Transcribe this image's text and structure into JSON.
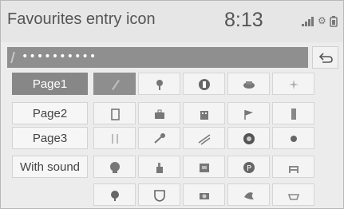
{
  "header": {
    "title": "Favourites entry icon",
    "clock": "8:13",
    "status_icons": [
      "signal-bars-icon",
      "settings-gear-icon",
      "battery-icon"
    ]
  },
  "input": {
    "value": "••••••••••"
  },
  "back_button": {
    "icon": "return-arrow-icon"
  },
  "pages": [
    {
      "label": "Page1",
      "active": true
    },
    {
      "label": "Page2",
      "active": false
    },
    {
      "label": "Page3",
      "active": false
    },
    {
      "label": "With sound",
      "active": false
    }
  ],
  "icon_grid": [
    [
      "pencil-icon",
      "pin-icon",
      "home-icon",
      "car-icon",
      "sparkle-icon"
    ],
    [
      "door-icon",
      "briefcase-icon",
      "building-icon",
      "flag-icon",
      "tower-icon"
    ],
    [
      "fork-icon",
      "shovel-icon",
      "road-icon",
      "face-icon",
      "dot-icon"
    ],
    [
      "globe-icon",
      "factory-icon",
      "shop-icon",
      "parking-icon",
      "bench-icon"
    ],
    [
      "tree-icon",
      "shield-icon",
      "camera-icon",
      "bird-icon",
      "cup-icon"
    ]
  ],
  "selected_icon": "pencil-icon"
}
